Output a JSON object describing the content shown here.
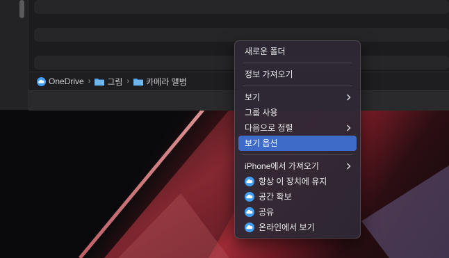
{
  "pathbar": {
    "items": [
      {
        "label": "OneDrive",
        "icon": "onedrive-cloud-icon"
      },
      {
        "label": "그림",
        "icon": "folder-icon"
      },
      {
        "label": "카메라 앨범",
        "icon": "folder-icon"
      }
    ]
  },
  "menu": {
    "new_folder": "새로운 폴더",
    "get_info": "정보 가져오기",
    "view": "보기",
    "use_groups": "그룹 사용",
    "sort_by": "다음으로 정렬",
    "show_view_options": "보기 옵션",
    "import_from_iphone": "iPhone에서 가져오기",
    "always_keep": "항상 이 장치에 유지",
    "free_up_space": "공간 확보",
    "share": "공유",
    "view_online": "온라인에서 보기"
  },
  "colors": {
    "accent": "#3d6bc7",
    "onedrive": "#3f9df3",
    "folder": "#5aa7e6"
  }
}
